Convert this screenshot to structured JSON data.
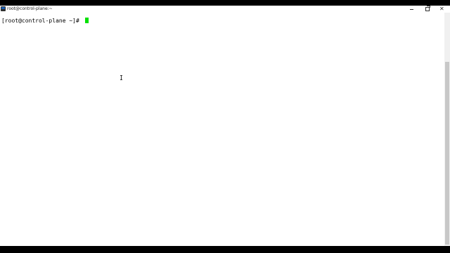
{
  "window": {
    "title": "root@control-plane:~",
    "close_glyph": "✕"
  },
  "terminal": {
    "prompt": "[root@control-plane ~]# ",
    "cursor_color": "#00e000"
  },
  "icons": {
    "app": "terminal-app-icon",
    "minimize": "minimize-icon",
    "maximize": "maximize-icon",
    "close": "close-icon",
    "pointer": "text-cursor-icon"
  }
}
